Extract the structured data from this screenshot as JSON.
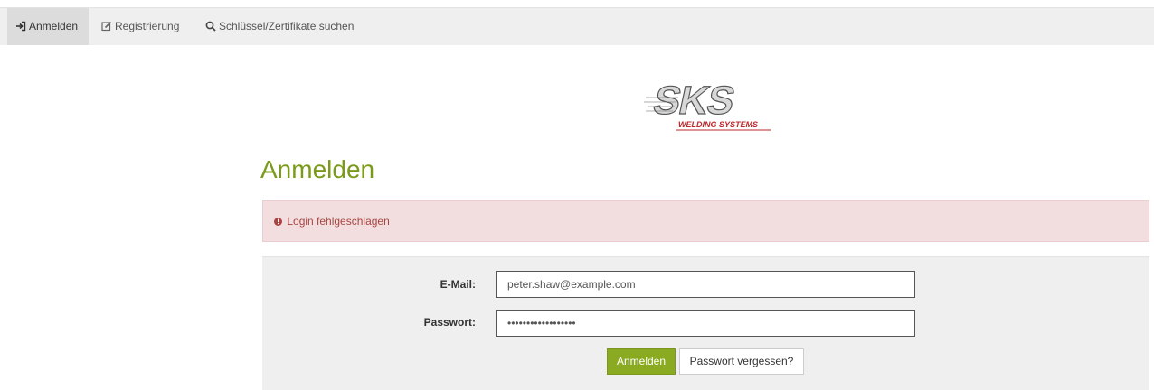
{
  "nav": {
    "items": [
      {
        "label": "Anmelden",
        "icon": "sign-in-icon",
        "active": true
      },
      {
        "label": "Registrierung",
        "icon": "edit-icon",
        "active": false
      },
      {
        "label": "Schlüssel/Zertifikate suchen",
        "icon": "search-icon",
        "active": false
      }
    ]
  },
  "logo": {
    "brand": "SKS",
    "tagline": "WELDING SYSTEMS"
  },
  "main": {
    "title": "Anmelden",
    "alert": {
      "icon": "exclamation-circle-icon",
      "text": "Login fehlgeschlagen"
    },
    "form": {
      "email_label": "E-Mail:",
      "email_value": "peter.shaw@example.com",
      "password_label": "Passwort:",
      "password_value": "••••••••••••••••••",
      "submit_label": "Anmelden",
      "forgot_label": "Passwort vergessen?"
    }
  },
  "colors": {
    "accent": "#8aaa22",
    "title": "#7a9a1a",
    "alert_bg": "#f2dede",
    "alert_text": "#a94442",
    "logo_red": "#c0272d"
  }
}
